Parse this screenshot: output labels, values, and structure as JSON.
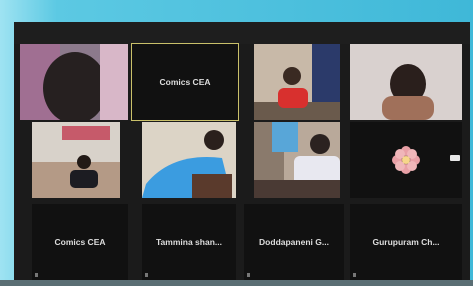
{
  "meeting": {
    "participants": [
      {
        "name": "",
        "video": true
      },
      {
        "name": "Comics CEA",
        "video": false,
        "active_speaker": true
      },
      {
        "name": "",
        "video": true
      },
      {
        "name": "",
        "video": true
      },
      {
        "name": "",
        "video": true
      },
      {
        "name": "",
        "video": true
      },
      {
        "name": "",
        "video": true
      },
      {
        "name": "",
        "video": false,
        "icon": "flower-avatar-icon"
      },
      {
        "name": "Comics CEA",
        "video": false
      },
      {
        "name": "Tammina shan...",
        "video": false
      },
      {
        "name": "Doddapaneni G...",
        "video": false
      },
      {
        "name": "Gurupuram Ch...",
        "video": false
      }
    ]
  },
  "colors": {
    "background": "#4fc3df",
    "tile": "#111111",
    "active_border": "#c9c06a",
    "flower": "#e9a0a6"
  }
}
